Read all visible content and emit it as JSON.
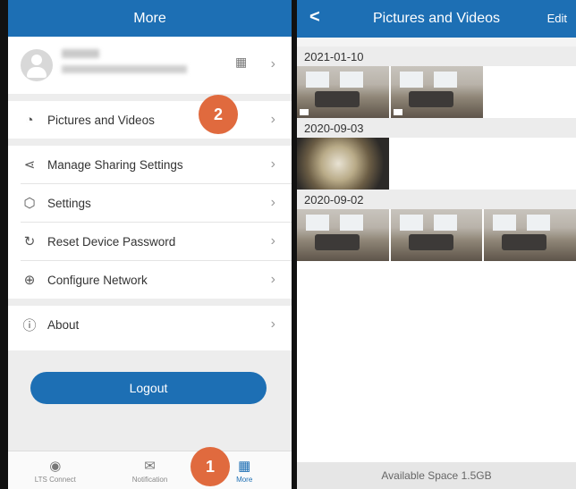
{
  "left": {
    "title": "More",
    "profile": {
      "name": "",
      "email": ""
    },
    "menu": [
      {
        "label": "Pictures and Videos",
        "icon": "pictures-icon"
      },
      {
        "label": "Manage Sharing Settings",
        "icon": "share-icon"
      },
      {
        "label": "Settings",
        "icon": "gear-icon"
      },
      {
        "label": "Reset Device Password",
        "icon": "reset-icon"
      },
      {
        "label": "Configure Network",
        "icon": "network-icon"
      },
      {
        "label": "About",
        "icon": "info-icon"
      }
    ],
    "logout": "Logout",
    "nav": [
      {
        "label": "LTS Connect",
        "icon": "lts-icon"
      },
      {
        "label": "Notification",
        "icon": "mail-icon"
      },
      {
        "label": "More",
        "icon": "grid-icon"
      }
    ]
  },
  "badges": {
    "one": "1",
    "two": "2"
  },
  "right": {
    "title": "Pictures and Videos",
    "edit": "Edit",
    "groups": [
      {
        "date": "2021-01-10"
      },
      {
        "date": "2020-09-03"
      },
      {
        "date": "2020-09-02"
      }
    ],
    "available": "Available Space 1.5GB"
  },
  "colors": {
    "accent": "#1d6fb4",
    "badge": "#e06a3e"
  }
}
